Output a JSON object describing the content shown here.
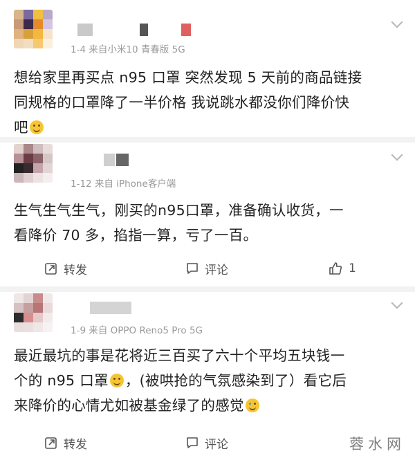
{
  "comments": [
    {
      "date": "1-4",
      "source": "来自小米10 青春版 5G",
      "text_lines": [
        "想给家里再买点 n95 口罩 突然发现 5 天前的商品链接",
        "同规格的口罩降了一半价格 我说跳水都没你们降价快",
        "吧"
      ],
      "emoji": "smile-emoji"
    },
    {
      "date": "1-12",
      "source": "来自 iPhone客户端",
      "text_lines": [
        "生气生气生气，刚买的n95口罩，准备确认收货，一",
        "看降价 70 多，掐指一算，亏了一百。"
      ],
      "actions": {
        "repost": "转发",
        "comment": "评论",
        "like": "1"
      }
    },
    {
      "date": "1-9",
      "source": "来自 OPPO Reno5 Pro 5G",
      "text_lines": [
        "最近最坑的事是花将近三百买了六十个平均五块钱一",
        "个的 n95 口罩",
        "，(被哄抢的气氛感染到了）看它后",
        "来降价的心情尤如被基金绿了的感觉"
      ],
      "actions": {
        "repost": "转发",
        "comment": "评论"
      }
    }
  ],
  "watermark": "蓉水网",
  "colors": {
    "meta": "#9a9a9a",
    "text": "#222222",
    "divider": "#f2f2f2"
  }
}
